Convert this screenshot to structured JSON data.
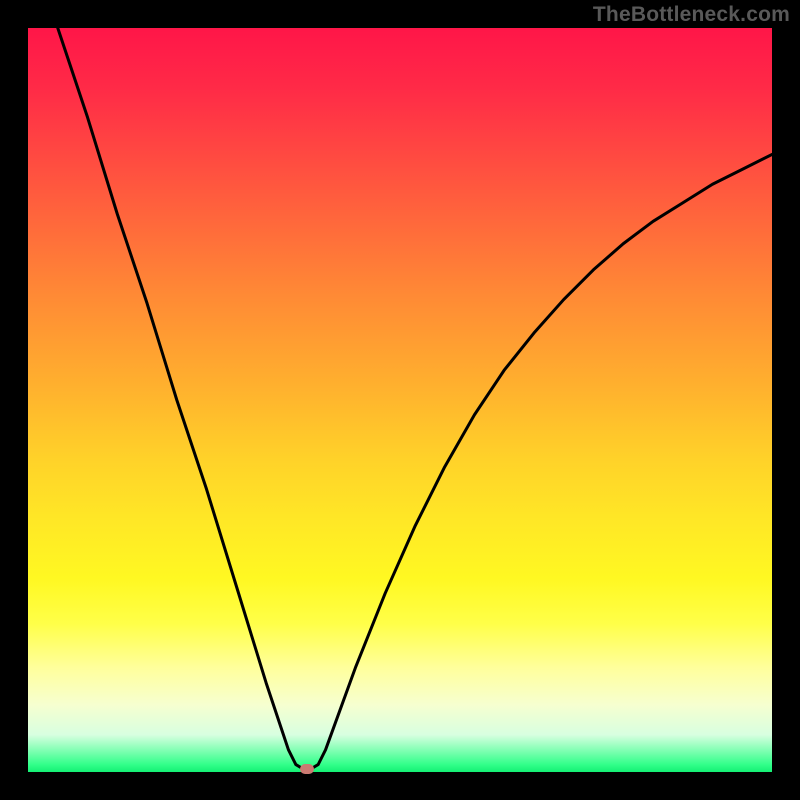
{
  "watermark": "TheBottleneck.com",
  "chart_data": {
    "type": "line",
    "title": "",
    "xlabel": "",
    "ylabel": "",
    "xlim": [
      0,
      100
    ],
    "ylim": [
      0,
      100
    ],
    "grid": false,
    "legend": false,
    "series": [
      {
        "name": "curve",
        "x": [
          4,
          8,
          12,
          16,
          20,
          24,
          28,
          32,
          34,
          35,
          36,
          37,
          38,
          39,
          40,
          44,
          48,
          52,
          56,
          60,
          64,
          68,
          72,
          76,
          80,
          84,
          88,
          92,
          96,
          100
        ],
        "y": [
          100,
          88,
          75,
          63,
          50,
          38,
          25,
          12,
          6,
          3,
          1,
          0.4,
          0.4,
          1,
          3,
          14,
          24,
          33,
          41,
          48,
          54,
          59,
          63.5,
          67.5,
          71,
          74,
          76.5,
          79,
          81,
          83
        ]
      }
    ],
    "marker": {
      "x": 37.5,
      "y": 0.4
    },
    "background_gradient": [
      "#ff1648",
      "#ff8a35",
      "#ffe726",
      "#ffff9c",
      "#14f074"
    ]
  }
}
